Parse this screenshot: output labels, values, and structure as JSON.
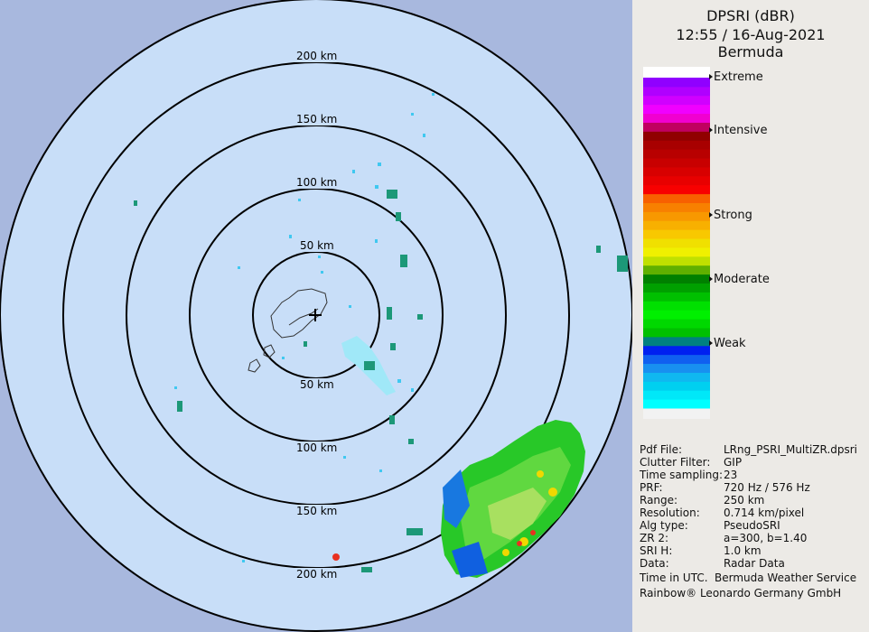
{
  "header": {
    "product": "DPSRI (dBR)",
    "time_date": "12:55 / 16-Aug-2021",
    "site": "Bermuda"
  },
  "legend": {
    "levels": [
      "Extreme",
      "Intensive",
      "Strong",
      "Moderate",
      "Weak"
    ],
    "colors": [
      "#00ffff",
      "#00e8f8",
      "#00d0f0",
      "#10b8f0",
      "#1890f0",
      "#1060f0",
      "#0020f0",
      "#008080",
      "#00c000",
      "#00d800",
      "#00f000",
      "#00e000",
      "#00c000",
      "#00a000",
      "#008000",
      "#60b000",
      "#c0e000",
      "#f0f000",
      "#f0e000",
      "#f8c800",
      "#f8b000",
      "#f89800",
      "#f88000",
      "#f86000",
      "#f80000",
      "#e80000",
      "#d80000",
      "#c80000",
      "#b80000",
      "#a80000",
      "#900000",
      "#c00060",
      "#f000d0",
      "#f000ff",
      "#d000ff",
      "#b000ff",
      "#9000ff"
    ]
  },
  "range_labels": {
    "north": [
      "200 km",
      "150 km",
      "100 km",
      "50 km"
    ],
    "south": [
      "50 km",
      "100 km",
      "150 km",
      "200 km"
    ]
  },
  "info": {
    "rows": [
      {
        "key": "Pdf File:",
        "value": "LRng_PSRI_MultiZR.dpsri"
      },
      {
        "key": "Clutter Filter:",
        "value": "GIP"
      },
      {
        "key": "Time sampling:",
        "value": "23"
      },
      {
        "key": "PRF:",
        "value": "720 Hz / 576 Hz"
      },
      {
        "key": "Range:",
        "value": "250 km"
      },
      {
        "key": "Resolution:",
        "value": "0.714 km/pixel"
      },
      {
        "key": "Alg type:",
        "value": "PseudoSRI"
      },
      {
        "key": "ZR 2:",
        "value": "a=300, b=1.40"
      },
      {
        "key": "SRI H:",
        "value": "1.0 km"
      },
      {
        "key": "Data:",
        "value": "Radar Data"
      }
    ],
    "time_note": "Time in UTC.",
    "service": "Bermuda Weather Service",
    "vendor": "Rainbow® Leonardo Germany GmbH"
  }
}
